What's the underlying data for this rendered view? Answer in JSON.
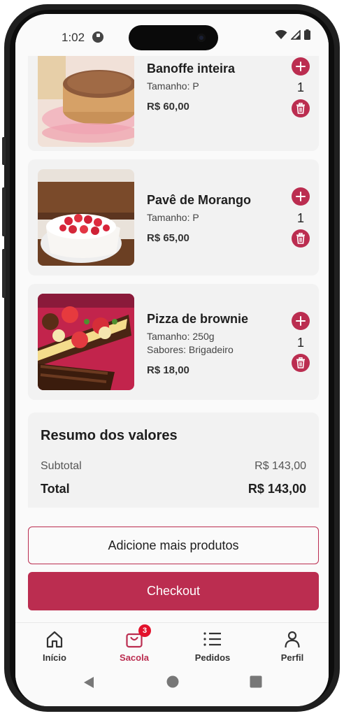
{
  "status_bar": {
    "time": "1:02"
  },
  "cart_items": [
    {
      "name": "Banoffe inteira",
      "details": [
        "Tamanho: P"
      ],
      "price": "R$ 60,00",
      "quantity": "1"
    },
    {
      "name": "Pavê de Morango",
      "details": [
        "Tamanho: P"
      ],
      "price": "R$ 65,00",
      "quantity": "1"
    },
    {
      "name": "Pizza de brownie",
      "details": [
        "Tamanho: 250g",
        "Sabores: Brigadeiro"
      ],
      "price": "R$ 18,00",
      "quantity": "1"
    }
  ],
  "summary": {
    "title": "Resumo dos valores",
    "subtotal_label": "Subtotal",
    "subtotal_value": "R$ 143,00",
    "total_label": "Total",
    "total_value": "R$ 143,00"
  },
  "actions": {
    "add_more_label": "Adicione mais produtos",
    "checkout_label": "Checkout"
  },
  "bottom_nav": {
    "items": [
      {
        "label": "Início",
        "icon": "home-icon"
      },
      {
        "label": "Sacola",
        "icon": "bag-icon",
        "badge": "3",
        "active": true
      },
      {
        "label": "Pedidos",
        "icon": "list-icon"
      },
      {
        "label": "Perfil",
        "icon": "person-icon"
      }
    ]
  },
  "colors": {
    "accent": "#bb2d50",
    "badge": "#e3122c",
    "card_bg": "#f2f2f2",
    "screen_bg": "#fafafa"
  }
}
